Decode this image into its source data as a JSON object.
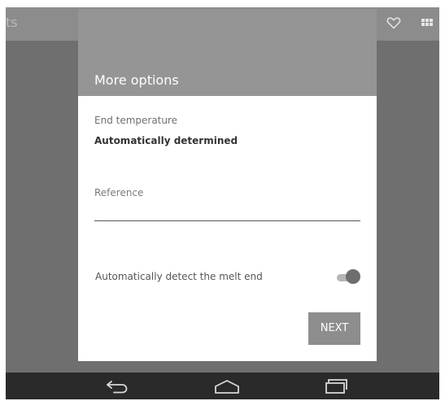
{
  "app_bar": {
    "title_fragment": "ts",
    "icons": [
      "heart-icon",
      "grid-icon"
    ]
  },
  "dialog": {
    "title": "More options",
    "end_temperature": {
      "label": "End temperature",
      "value": "Automatically determined"
    },
    "reference": {
      "label": "Reference",
      "value": ""
    },
    "auto_detect": {
      "label": "Automatically detect the melt end",
      "enabled": true
    },
    "next_label": "NEXT"
  },
  "nav_bar": {
    "buttons": [
      "back-icon",
      "home-icon",
      "recents-icon"
    ]
  }
}
